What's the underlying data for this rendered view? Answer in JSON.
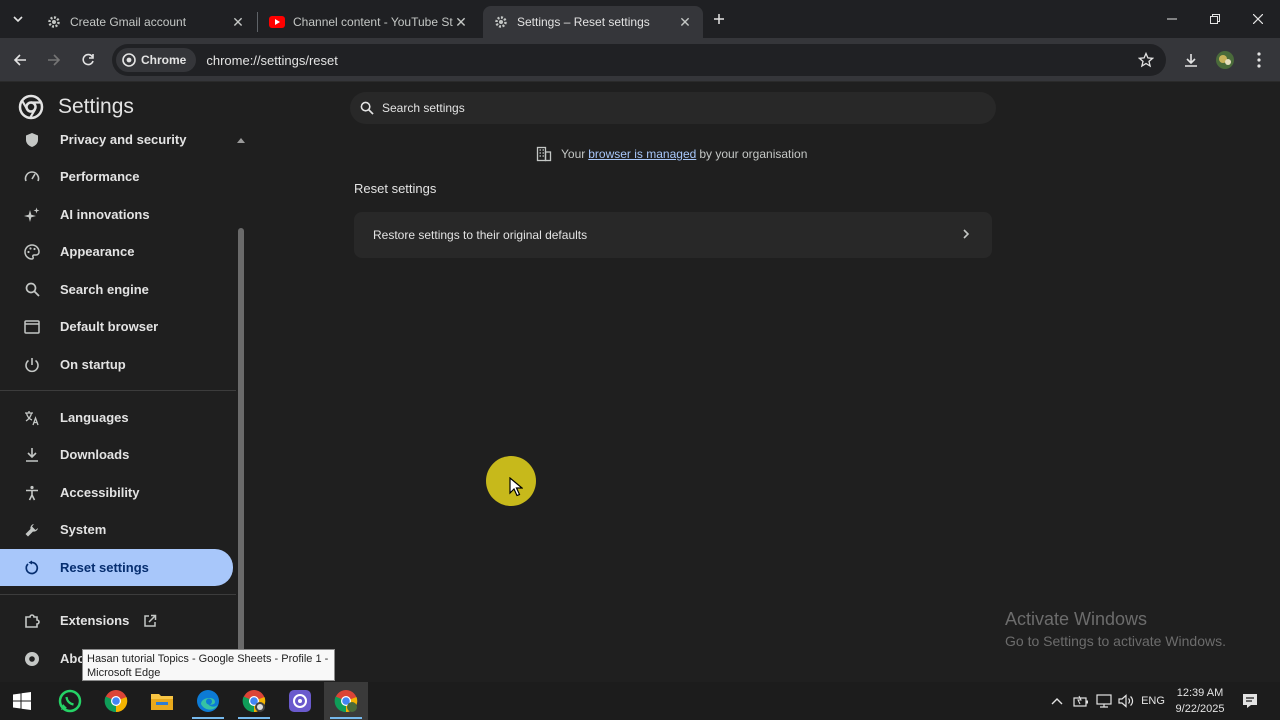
{
  "tabs": [
    {
      "label": "Create Gmail account",
      "icon": "gear-icon"
    },
    {
      "label": "Channel content - YouTube Stu",
      "icon": "youtube-icon"
    },
    {
      "label": "Settings – Reset settings",
      "icon": "gear-icon"
    }
  ],
  "toolbar": {
    "chip_label": "Chrome",
    "url": "chrome://settings/reset"
  },
  "sidebar": {
    "title": "Settings",
    "items": [
      {
        "label": "Privacy and security",
        "icon": "shield-icon"
      },
      {
        "label": "Performance",
        "icon": "speedometer-icon"
      },
      {
        "label": "AI innovations",
        "icon": "sparkle-icon"
      },
      {
        "label": "Appearance",
        "icon": "palette-icon"
      },
      {
        "label": "Search engine",
        "icon": "search-icon"
      },
      {
        "label": "Default browser",
        "icon": "browser-window-icon"
      },
      {
        "label": "On startup",
        "icon": "power-icon"
      },
      {
        "label": "Languages",
        "icon": "translate-icon"
      },
      {
        "label": "Downloads",
        "icon": "download-icon"
      },
      {
        "label": "Accessibility",
        "icon": "accessibility-icon"
      },
      {
        "label": "System",
        "icon": "wrench-icon"
      },
      {
        "label": "Reset settings",
        "icon": "reset-icon"
      },
      {
        "label": "Extensions",
        "icon": "puzzle-icon"
      },
      {
        "label": "Abo",
        "icon": "chrome-icon"
      }
    ]
  },
  "main": {
    "search_placeholder": "Search settings",
    "managed_prefix": "Your",
    "managed_link": "browser is managed",
    "managed_suffix": "by your organisation",
    "section_title": "Reset settings",
    "restore_label": "Restore settings to their original defaults"
  },
  "watermark": {
    "line1": "Activate Windows",
    "line2": "Go to Settings to activate Windows."
  },
  "tooltip": {
    "line1": "Hasan tutorial Topics - Google Sheets - Profile 1 -",
    "line2": "Microsoft Edge"
  },
  "taskbar": {
    "apps": [
      "windows-start-icon",
      "whatsapp-icon",
      "chrome-icon",
      "file-explorer-icon",
      "edge-icon",
      "chrome-profile-icon",
      "photo-app-icon",
      "chrome-active-icon"
    ],
    "language": "ENG",
    "time": "12:39 AM",
    "date": "9/22/2025"
  },
  "colors": {
    "accent": "#a8c7fa",
    "cursor_highlight": "#d6c71b"
  }
}
